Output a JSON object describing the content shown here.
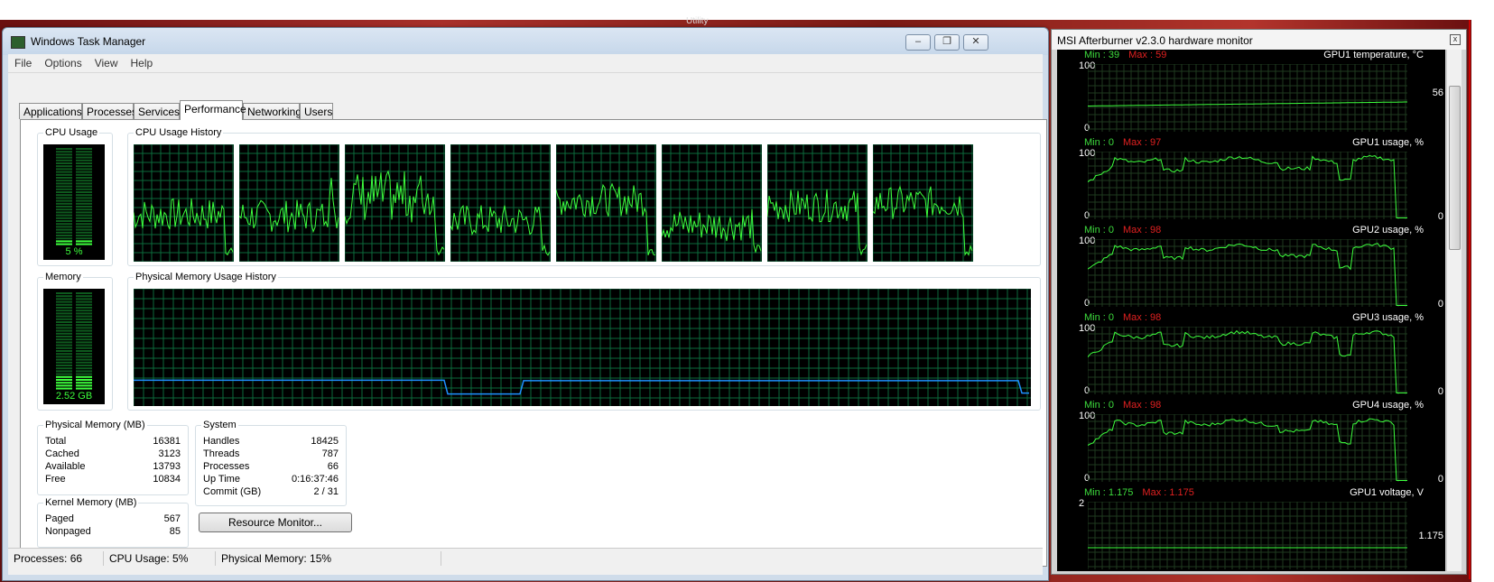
{
  "background": {
    "top_text": "Utility"
  },
  "task_manager": {
    "title": "Windows Task Manager",
    "window_buttons": {
      "minimize": "–",
      "restore": "❐",
      "close": "✕"
    },
    "menu": [
      "File",
      "Options",
      "View",
      "Help"
    ],
    "tabs": [
      "Applications",
      "Processes",
      "Services",
      "Performance",
      "Networking",
      "Users"
    ],
    "active_tab": "Performance",
    "cpu_usage": {
      "label": "CPU Usage",
      "value": "5 %",
      "level": 0.05
    },
    "cpu_history": {
      "label": "CPU Usage History",
      "cores": 8
    },
    "memory": {
      "label": "Memory",
      "value": "2.52 GB",
      "level": 0.15
    },
    "memory_history": {
      "label": "Physical Memory Usage History"
    },
    "physical_memory": {
      "label": "Physical Memory (MB)",
      "rows": [
        {
          "k": "Total",
          "v": "16381"
        },
        {
          "k": "Cached",
          "v": "3123"
        },
        {
          "k": "Available",
          "v": "13793"
        },
        {
          "k": "Free",
          "v": "10834"
        }
      ]
    },
    "kernel_memory": {
      "label": "Kernel Memory (MB)",
      "rows": [
        {
          "k": "Paged",
          "v": "567"
        },
        {
          "k": "Nonpaged",
          "v": "85"
        }
      ]
    },
    "system": {
      "label": "System",
      "rows": [
        {
          "k": "Handles",
          "v": "18425"
        },
        {
          "k": "Threads",
          "v": "787"
        },
        {
          "k": "Processes",
          "v": "66"
        },
        {
          "k": "Up Time",
          "v": "0:16:37:46"
        },
        {
          "k": "Commit (GB)",
          "v": "2 / 31"
        }
      ]
    },
    "resource_monitor_button": "Resource Monitor...",
    "status": {
      "processes": "Processes: 66",
      "cpu": "CPU Usage: 5%",
      "memory": "Physical Memory: 15%"
    }
  },
  "afterburner": {
    "title": "MSI Afterburner v2.3.0 hardware monitor",
    "close": "x",
    "panels": [
      {
        "name": "GPU1 temperature, °C",
        "min": "Min : 39",
        "max": "Max : 59",
        "ymax": "100",
        "ymin": "0",
        "current": "56"
      },
      {
        "name": "GPU1 usage, %",
        "min": "Min : 0",
        "max": "Max : 97",
        "ymax": "100",
        "ymin": "0",
        "current": "0"
      },
      {
        "name": "GPU2 usage, %",
        "min": "Min : 0",
        "max": "Max : 98",
        "ymax": "100",
        "ymin": "0",
        "current": "0"
      },
      {
        "name": "GPU3 usage, %",
        "min": "Min : 0",
        "max": "Max : 98",
        "ymax": "100",
        "ymin": "0",
        "current": "0"
      },
      {
        "name": "GPU4 usage, %",
        "min": "Min : 0",
        "max": "Max : 98",
        "ymax": "100",
        "ymin": "0",
        "current": "0"
      },
      {
        "name": "GPU1 voltage, V",
        "min": "Min : 1.175",
        "max": "Max : 1.175",
        "ymax": "2",
        "ymin": "",
        "current": "1.175"
      }
    ]
  },
  "colors": {
    "graph_green": "#3dff3d",
    "grid": "#0c6a3c",
    "memory_line": "#1e90ff"
  }
}
